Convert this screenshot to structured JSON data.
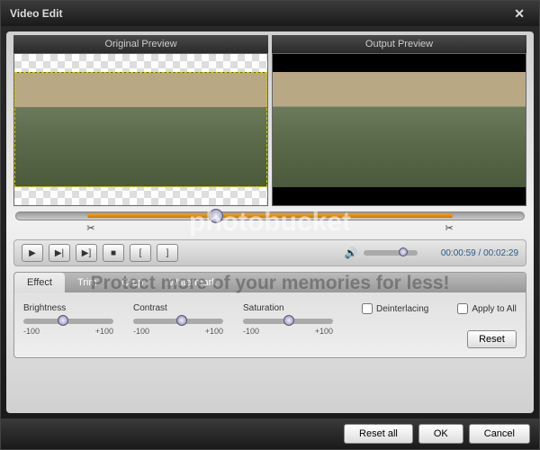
{
  "window": {
    "title": "Video Edit"
  },
  "previews": {
    "original": "Original Preview",
    "output": "Output Preview"
  },
  "watermark": {
    "brand": "photobucket",
    "tagline": "Protect more of your memories for less!"
  },
  "playback": {
    "time": "00:00:59 / 00:02:29"
  },
  "tabs": {
    "effect": "Effect",
    "trim": "Trim",
    "crop": "Crop",
    "watermark": "Watermark"
  },
  "effect": {
    "brightness": {
      "label": "Brightness",
      "min": "-100",
      "max": "+100",
      "pos": 38
    },
    "contrast": {
      "label": "Contrast",
      "min": "-100",
      "max": "+100",
      "pos": 48
    },
    "saturation": {
      "label": "Saturation",
      "min": "-100",
      "max": "+100",
      "pos": 45
    },
    "deinterlacing": "Deinterlacing",
    "apply_all": "Apply to All",
    "reset": "Reset"
  },
  "footer": {
    "reset_all": "Reset all",
    "ok": "OK",
    "cancel": "Cancel"
  },
  "icons": {
    "play": "▶",
    "step": "▶|",
    "next": "▶]",
    "stop": "■",
    "in": "[",
    "out": "]",
    "scissors": "✂",
    "volume": "🔊",
    "close": "✕"
  }
}
